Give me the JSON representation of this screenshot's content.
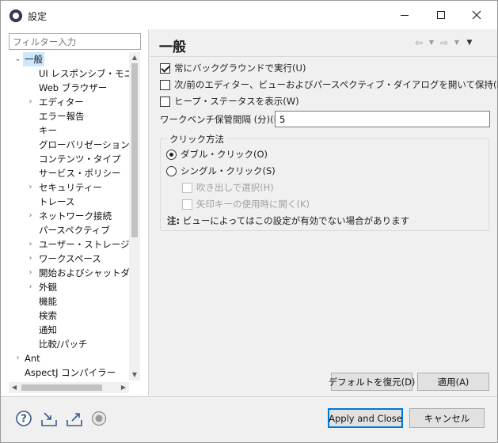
{
  "window": {
    "title": "設定"
  },
  "sidebar": {
    "filter_placeholder": "フィルター入力",
    "tree": [
      {
        "label": "一般",
        "chevron": "⌄",
        "selected": true
      },
      {
        "label": "UI レスポンシブ・モニター"
      },
      {
        "label": "Web ブラウザー"
      },
      {
        "label": "エディター",
        "chevron": "›"
      },
      {
        "label": "エラー報告"
      },
      {
        "label": "キー"
      },
      {
        "label": "グローバリゼーション"
      },
      {
        "label": "コンテンツ・タイプ"
      },
      {
        "label": "サービス・ポリシー"
      },
      {
        "label": "セキュリティー",
        "chevron": "›"
      },
      {
        "label": "トレース"
      },
      {
        "label": "ネットワーク接続",
        "chevron": "›"
      },
      {
        "label": "パースペクティブ"
      },
      {
        "label": "ユーザー・ストレージ・サー",
        "chevron": "›"
      },
      {
        "label": "ワークスペース",
        "chevron": "›"
      },
      {
        "label": "開始およびシャットダウン",
        "chevron": "›"
      },
      {
        "label": "外観",
        "chevron": "›"
      },
      {
        "label": "機能"
      },
      {
        "label": "検索"
      },
      {
        "label": "通知"
      },
      {
        "label": "比較/パッチ"
      },
      {
        "label": "Ant",
        "chevron": "›"
      },
      {
        "label": "AspectJ コンパイラー"
      }
    ]
  },
  "main": {
    "page_title": "一般",
    "options": {
      "always_background": "常にバックグラウンドで実行(U)",
      "keep_next_prev": "次/前のエディター、ビューおよびパースペクティブ・ダイアログを開いて保持(N)",
      "show_heap": "ヒープ・ステータスを表示(W)"
    },
    "save_interval_label": "ワークベンチ保管間隔 (分)(I):",
    "save_interval_value": "5",
    "click_group": {
      "title": "クリック方法",
      "double_click": "ダブル・クリック(O)",
      "single_click": "シングル・クリック(S)",
      "select_on_hover": "吹き出しで選択(H)",
      "open_on_arrow": "矢印キーの使用時に開く(K)",
      "note_prefix": "注:",
      "note_text": " ビューによってはこの設定が有効でない場合があります"
    },
    "restore_defaults_label": "デフォルトを復元(D)",
    "apply_label": "適用(A)"
  },
  "footer": {
    "apply_close_label": "Apply and Close",
    "cancel_label": "キャンセル"
  }
}
